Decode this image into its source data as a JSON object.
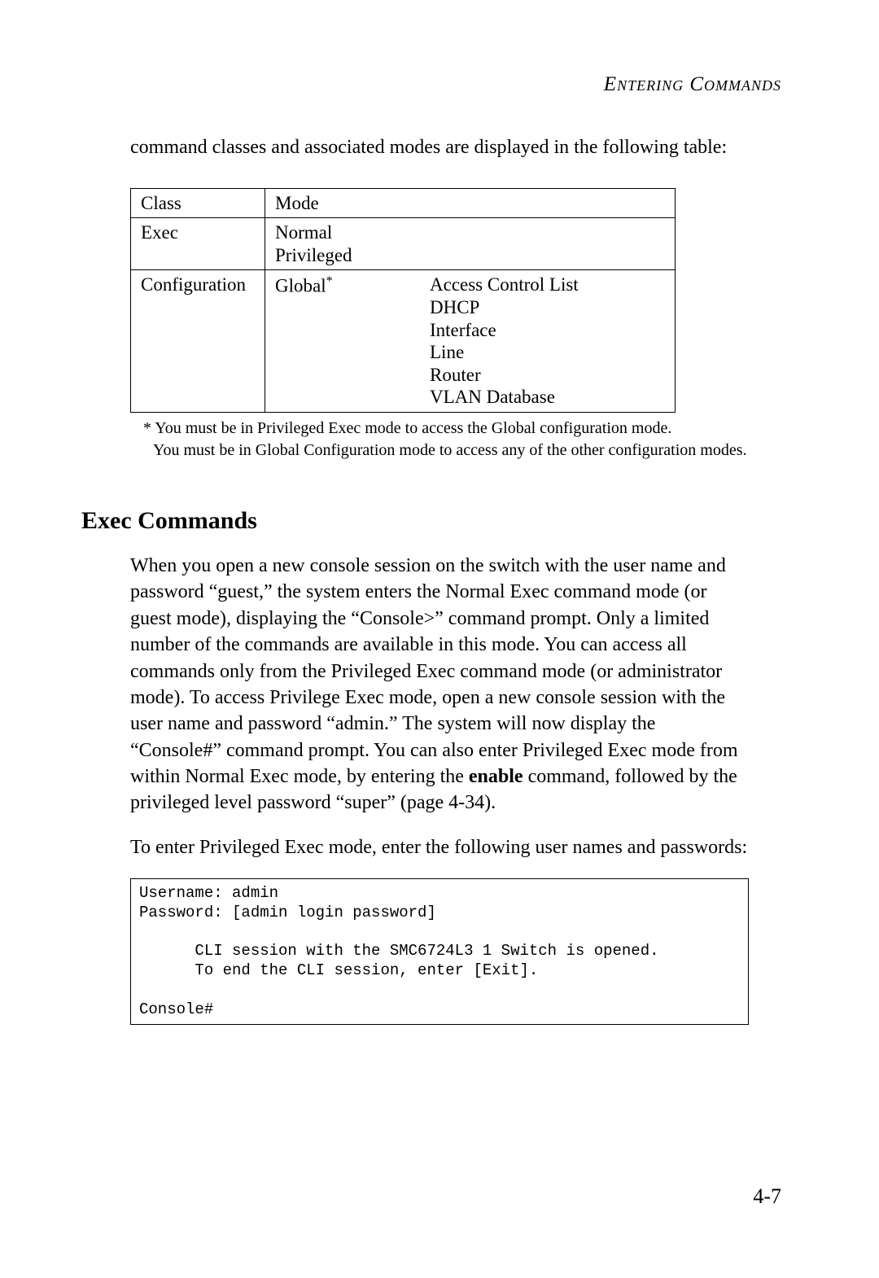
{
  "header": {
    "running_title": "Entering Commands"
  },
  "intro": "command classes and associated modes are displayed in the following table:",
  "table": {
    "headers": [
      "Class",
      "Mode"
    ],
    "rows": [
      {
        "class": "Exec",
        "mode_left": [
          "Normal",
          "Privileged"
        ],
        "mode_right": []
      },
      {
        "class": "Configuration",
        "mode_left": [
          "Global"
        ],
        "mode_left_sup": "*",
        "mode_right": [
          "Access Control List",
          "DHCP",
          "Interface",
          "Line",
          "Router",
          "VLAN Database"
        ]
      }
    ]
  },
  "footnote_star": "*",
  "footnote_line1": " You must be in Privileged Exec mode to access the Global configuration mode.",
  "footnote_line2": "You must be in Global Configuration mode to access any of the other configuration modes.",
  "section_heading": "Exec Commands",
  "para1_part1": "When you open a new console session on the switch with the user name and password “guest,” the system enters the Normal Exec command mode (or guest mode), displaying the “Console>” command prompt. Only a limited number of the commands are available in this mode. You can access all commands only from the Privileged Exec command mode (or administrator mode). To access Privilege Exec mode, open a new console session with the user name and password “admin.” The system will now display the “Console#” command prompt. You can also enter Privileged Exec mode from within Normal Exec mode, by entering the ",
  "para1_bold": "enable",
  "para1_part2": " command, followed by the privileged level password “super” (page 4-34).",
  "para2": "To enter Privileged Exec mode, enter the following user names and passwords:",
  "console": "Username: admin\nPassword: [admin login password]\n\n      CLI session with the SMC6724L3 1 Switch is opened.\n      To end the CLI session, enter [Exit].\n\nConsole#",
  "page_number": "4-7"
}
